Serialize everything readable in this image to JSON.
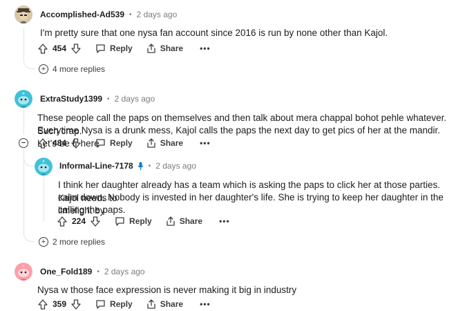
{
  "comments": [
    {
      "author": "Accomplished-Ad539",
      "time": "2 days ago",
      "text": "I'm pretty sure that one nysa fan account since 2016 is run by none other than Kajol.",
      "score": "454",
      "more_replies": "4 more replies"
    },
    {
      "author": "ExtraStudy1399",
      "time": "2 days ago",
      "text_line1": "These people call the paps on themselves and then talk about mera chappal bohot pehle whatever. Such crap.",
      "text_line2": "Everytime Nysa is a drunk mess, Kajol calls the paps the next day to get pics of her at the mandir. Let's be fr here",
      "score": "484"
    },
    {
      "author": "Informal-Line-7178",
      "time": "2 days ago",
      "text_line1": "I think her daughter already has a team which is asking the paps to click her at those parties. Kajol needs to",
      "text_line2": "calm down. Nobody is invested in her daughter's life. She is trying to keep her daughter in the limelight by",
      "text_line3": "calling the paps.",
      "score": "224",
      "more_replies": "2 more replies"
    },
    {
      "author": "One_Fold189",
      "time": "2 days ago",
      "text": "Nysa w those face expression is never making it big in industry",
      "score": "359"
    }
  ],
  "actions": {
    "reply": "Reply",
    "share": "Share",
    "more": "•••",
    "dot": "•"
  },
  "colors": {
    "accent_blue": "#0079d3",
    "avatar_teal": "#3fc1d8",
    "avatar_pink": "#ff9ea8",
    "avatar_dark": "#4a3d2e"
  }
}
